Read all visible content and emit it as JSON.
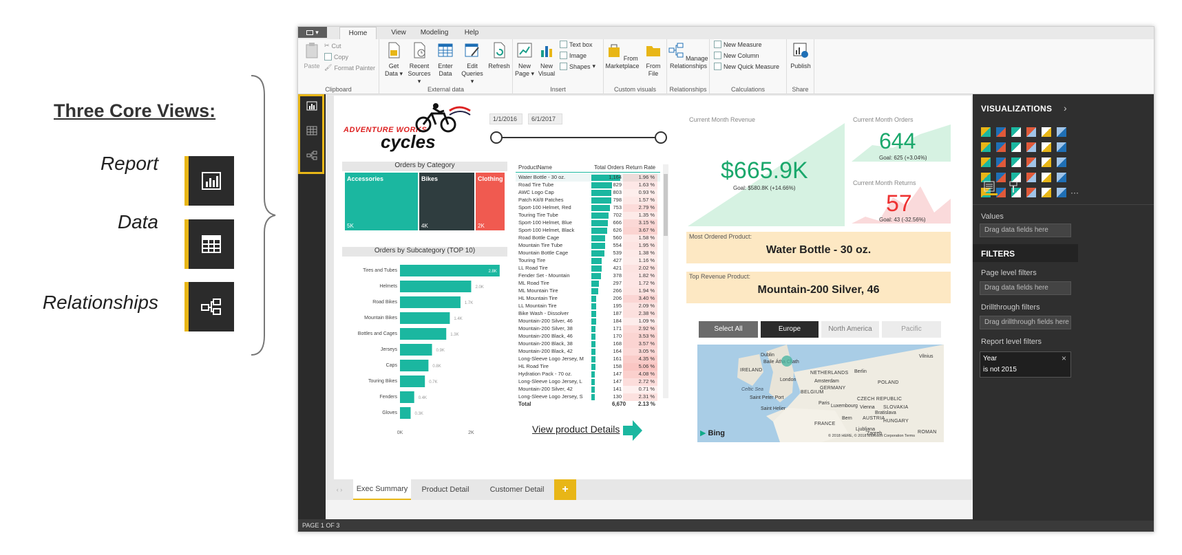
{
  "legend": {
    "title": "Three Core Views:",
    "items": [
      {
        "label": "Report",
        "icon": "report-view-icon"
      },
      {
        "label": "Data",
        "icon": "data-view-icon"
      },
      {
        "label": "Relationships",
        "icon": "relationships-view-icon"
      }
    ]
  },
  "ribbon": {
    "file_menu": "▾",
    "tabs": [
      "Home",
      "View",
      "Modeling",
      "Help"
    ],
    "groups": {
      "clipboard": {
        "name": "Clipboard",
        "paste": "Paste",
        "cut": "Cut",
        "copy": "Copy",
        "format_painter": "Format Painter"
      },
      "external": {
        "name": "External data",
        "get_data": "Get Data",
        "recent_sources": "Recent Sources",
        "enter_data": "Enter Data",
        "edit_queries": "Edit Queries",
        "refresh": "Refresh"
      },
      "insert": {
        "name": "Insert",
        "new_page": "New Page",
        "new_visual": "New Visual",
        "text_box": "Text box",
        "image": "Image",
        "shapes": "Shapes"
      },
      "custom": {
        "name": "Custom visuals",
        "marketplace": "From Marketplace",
        "file": "From File"
      },
      "relationships": {
        "name": "Relationships",
        "manage": "Manage Relationships"
      },
      "calculations": {
        "name": "Calculations",
        "new_measure": "New Measure",
        "new_column": "New Column",
        "new_quick_measure": "New Quick Measure"
      },
      "share": {
        "name": "Share",
        "publish": "Publish"
      }
    }
  },
  "report": {
    "logo_top": "ADVENTURE WORKS",
    "logo_bottom": "cycles",
    "date_from": "1/1/2016",
    "date_to": "6/1/2017",
    "orders_by_category": {
      "title": "Orders by Category",
      "items": [
        {
          "label": "Accessories",
          "value": "5K",
          "color": "#1bb7a0"
        },
        {
          "label": "Bikes",
          "value": "4K",
          "color": "#2f3d3f"
        },
        {
          "label": "Clothing",
          "value": "2K",
          "color": "#f05a50"
        }
      ]
    },
    "table": {
      "headers": [
        "ProductName",
        "Total Orders",
        "Return Rate"
      ],
      "rows": [
        [
          "Water Bottle - 30 oz.",
          "1,164",
          "1.96 %"
        ],
        [
          "Road Tire Tube",
          "829",
          "1.63 %"
        ],
        [
          "AWC Logo Cap",
          "803",
          "0.93 %"
        ],
        [
          "Patch Kit/8 Patches",
          "798",
          "1.57 %"
        ],
        [
          "Sport-100 Helmet, Red",
          "753",
          "2.79 %"
        ],
        [
          "Touring Tire Tube",
          "702",
          "1.35 %"
        ],
        [
          "Sport-100 Helmet, Blue",
          "666",
          "3.15 %"
        ],
        [
          "Sport-100 Helmet, Black",
          "626",
          "3.67 %"
        ],
        [
          "Road Bottle Cage",
          "560",
          "1.58 %"
        ],
        [
          "Mountain Tire Tube",
          "554",
          "1.95 %"
        ],
        [
          "Mountain Bottle Cage",
          "539",
          "1.38 %"
        ],
        [
          "Touring Tire",
          "427",
          "1.16 %"
        ],
        [
          "LL Road Tire",
          "421",
          "2.02 %"
        ],
        [
          "Fender Set - Mountain",
          "378",
          "1.82 %"
        ],
        [
          "ML Road Tire",
          "297",
          "1.72 %"
        ],
        [
          "ML Mountain Tire",
          "266",
          "1.94 %"
        ],
        [
          "HL Mountain Tire",
          "206",
          "3.40 %"
        ],
        [
          "LL Mountain Tire",
          "195",
          "2.09 %"
        ],
        [
          "Bike Wash - Dissolver",
          "187",
          "2.38 %"
        ],
        [
          "Mountain-200 Silver, 46",
          "184",
          "1.09 %"
        ],
        [
          "Mountain-200 Silver, 38",
          "171",
          "2.92 %"
        ],
        [
          "Mountain-200 Black, 46",
          "170",
          "3.53 %"
        ],
        [
          "Mountain-200 Black, 38",
          "168",
          "3.57 %"
        ],
        [
          "Mountain-200 Black, 42",
          "164",
          "3.05 %"
        ],
        [
          "Long-Sleeve Logo Jersey, M",
          "161",
          "4.35 %"
        ],
        [
          "HL Road Tire",
          "158",
          "5.06 %"
        ],
        [
          "Hydration Pack - 70 oz.",
          "147",
          "4.08 %"
        ],
        [
          "Long-Sleeve Logo Jersey, L",
          "147",
          "2.72 %"
        ],
        [
          "Mountain-200 Silver, 42",
          "141",
          "0.71 %"
        ],
        [
          "Long-Sleeve Logo Jersey, S",
          "130",
          "2.31 %"
        ]
      ],
      "total": [
        "Total",
        "6,670",
        "2.13 %"
      ]
    },
    "view_details": "View product Details",
    "revenue": {
      "label": "Current Month Revenue",
      "value": "$665.9K",
      "goal": "Goal: $580.8K (+14.66%)"
    },
    "orders": {
      "label": "Current Month Orders",
      "value": "644",
      "goal": "Goal: 625 (+3.04%)"
    },
    "returns": {
      "label": "Current Month Returns",
      "value": "57",
      "goal": "Goal: 43 (-32.56%)"
    },
    "most_ordered": {
      "label": "Most Ordered Product:",
      "value": "Water Bottle - 30 oz."
    },
    "top_revenue": {
      "label": "Top Revenue Product:",
      "value": "Mountain-200 Silver, 46"
    },
    "region_buttons": [
      "Select All",
      "Europe",
      "North America",
      "Pacific"
    ],
    "map": {
      "labels": [
        "Dublin",
        "Baile Átha Cliath",
        "IRELAND",
        "London",
        "NETHERLANDS",
        "Amsterdam",
        "Berlin",
        "GERMANY",
        "POLAND",
        "BELGIUM",
        "Celtic Sea",
        "Saint Peter Port",
        "Paris",
        "Luxembourg",
        "CZECH REPUBLIC",
        "Vienna",
        "SLOVAKIA",
        "Bratislava",
        "Saint Helier",
        "HUNGARY",
        "AUSTRIA",
        "FRANCE",
        "Bern",
        "Ljubljana",
        "Zagreb",
        "ROMAN",
        "Vilnius"
      ],
      "brand": "Bing",
      "copyright": "© 2018 HERE, © 2018 Microsoft Corporation Terms"
    }
  },
  "chart_data": {
    "type": "bar",
    "title": "Orders by Subcategory (TOP 10)",
    "categories": [
      "Tires and Tubes",
      "Helmets",
      "Road Bikes",
      "Mountain Bikes",
      "Bottles and Cages",
      "Jerseys",
      "Caps",
      "Touring Bikes",
      "Fenders",
      "Gloves"
    ],
    "values": [
      2800,
      2000,
      1700,
      1400,
      1300,
      900,
      800,
      700,
      400,
      300
    ],
    "data_labels": [
      "2.8K",
      "2.0K",
      "1.7K",
      "1.4K",
      "1.3K",
      "0.9K",
      "0.8K",
      "0.7K",
      "0.4K",
      "0.3K"
    ],
    "xticks": [
      "0K",
      "2K"
    ],
    "xlim": [
      0,
      2900
    ],
    "orientation": "horizontal",
    "color": "#1bb7a0"
  },
  "page_tabs": [
    "Exec Summary",
    "Product Detail",
    "Customer Detail"
  ],
  "add_page": "+",
  "status": "PAGE 1 OF 3",
  "visualizations": {
    "title": "VISUALIZATIONS",
    "values_label": "Values",
    "drag_values": "Drag data fields here",
    "filters_title": "FILTERS",
    "page_filters": "Page level filters",
    "drag_page": "Drag data fields here",
    "drillthrough": "Drillthrough filters",
    "drag_drill": "Drag drillthrough fields here",
    "report_filters": "Report level filters",
    "filter_card": {
      "title": "Year",
      "value": "is not 2015"
    },
    "more": "···"
  },
  "colors": {
    "accent": "#e8b617",
    "teal": "#1bb7a0",
    "red": "#f05a50"
  }
}
